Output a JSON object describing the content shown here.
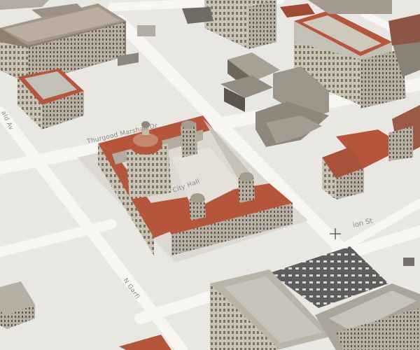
{
  "map": {
    "street_labels": {
      "thurgood": "Thurgood Marshall Dr",
      "north_garfield": "N Garfi",
      "union": "ion St",
      "left_edge": "ald Av"
    },
    "building_labels": {
      "city_hall": "City Hall"
    },
    "cursor": "crosshair-cursor",
    "colors": {
      "ground": "#e9e7e2",
      "road": "#f6f5f2",
      "roof_terracotta": "#b5563c",
      "stone": "#d8d2c4",
      "parking": "#5f5e5c"
    }
  }
}
